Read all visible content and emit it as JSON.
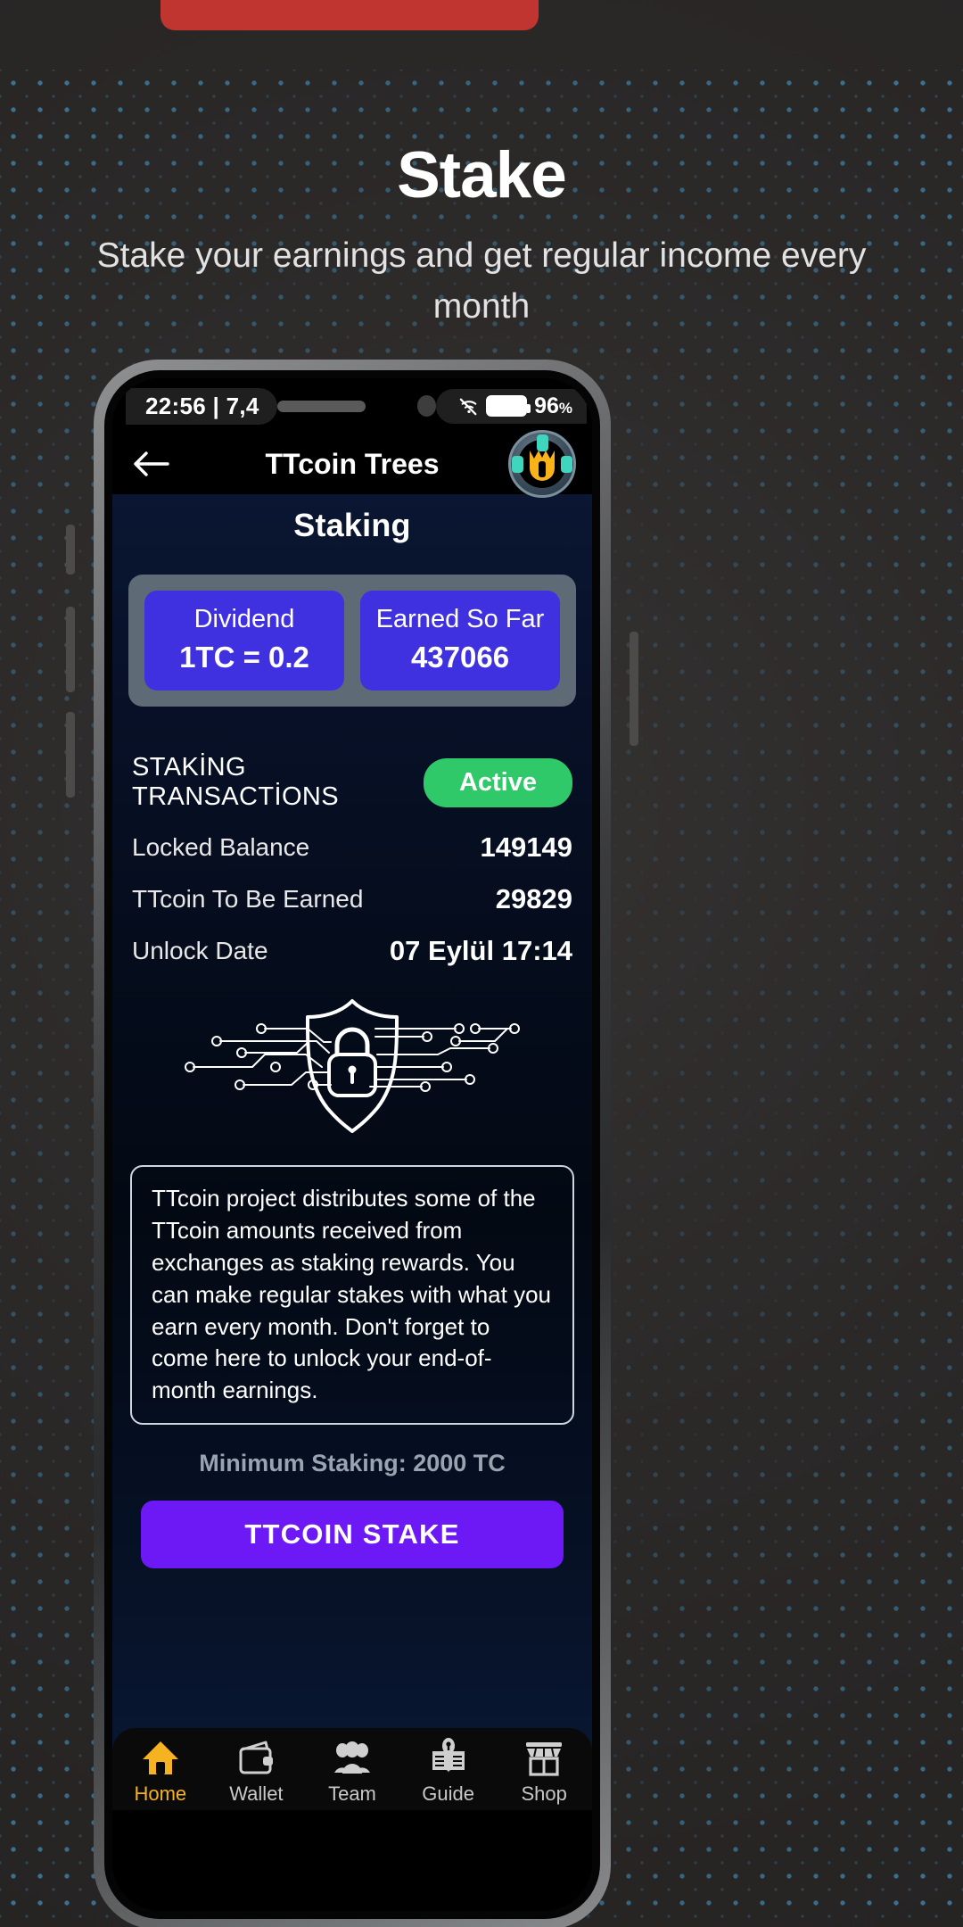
{
  "promo": {
    "title": "Stake",
    "subtitle": "Stake your earnings and get regular income every month"
  },
  "status_bar": {
    "left_text": "22:56 | 7,4",
    "battery_percent": "96",
    "battery_unit": "%",
    "wifi_icon": "wifi-off-icon",
    "battery_icon": "battery-full-icon"
  },
  "app_header": {
    "back_icon": "back-arrow-icon",
    "title": "TTcoin Trees",
    "logo_icon": "ttcoin-logo-icon"
  },
  "page": {
    "title": "Staking"
  },
  "stats": [
    {
      "label": "Dividend",
      "value": "1TC = 0.2"
    },
    {
      "label": "Earned So Far",
      "value": "437066"
    }
  ],
  "transactions": {
    "title": "STAKİNG TRANSACTİONS",
    "status_badge": "Active",
    "rows": [
      {
        "label": "Locked Balance",
        "value": "149149"
      },
      {
        "label": "TTcoin To Be Earned",
        "value": "29829"
      },
      {
        "label": "Unlock Date",
        "value": "07 Eylül 17:14"
      }
    ]
  },
  "illustration": {
    "icon": "shield-lock-circuit-icon"
  },
  "info_text": "TTcoin project distributes some of the TTcoin amounts received from exchanges as staking rewards. You can make regular stakes with what you earn every month. Don't forget to come here to unlock your end-of-month earnings.",
  "min_staking": "Minimum Staking: 2000 TC",
  "cta_label": "TTCOIN STAKE",
  "bottom_nav": [
    {
      "icon": "home-icon",
      "label": "Home",
      "active": true
    },
    {
      "icon": "wallet-icon",
      "label": "Wallet",
      "active": false
    },
    {
      "icon": "team-icon",
      "label": "Team",
      "active": false
    },
    {
      "icon": "guide-icon",
      "label": "Guide",
      "active": false
    },
    {
      "icon": "shop-icon",
      "label": "Shop",
      "active": false
    }
  ],
  "colors": {
    "accent_purple": "#6d19f5",
    "card_purple": "#3f31e0",
    "active_green": "#2fc96a",
    "brand_yellow": "#f5b321",
    "promo_red": "#c0352f"
  }
}
